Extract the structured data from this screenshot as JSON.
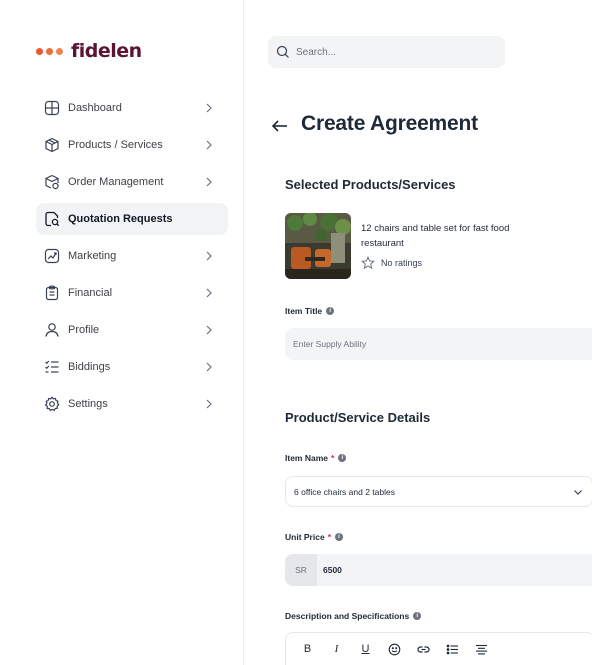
{
  "brand": {
    "name": "fidelen"
  },
  "search": {
    "placeholder": "Search..."
  },
  "sidebar": {
    "items": [
      {
        "label": "Dashboard",
        "icon": "dashboard-icon"
      },
      {
        "label": "Products / Services",
        "icon": "box-icon"
      },
      {
        "label": "Order Management",
        "icon": "order-icon"
      },
      {
        "label": "Quotation Requests",
        "icon": "quotation-icon",
        "active": true
      },
      {
        "label": "Marketing",
        "icon": "chart-icon"
      },
      {
        "label": "Financial",
        "icon": "receipt-icon"
      },
      {
        "label": "Profile",
        "icon": "user-icon"
      },
      {
        "label": "Biddings",
        "icon": "list-icon"
      },
      {
        "label": "Settings",
        "icon": "gear-icon"
      }
    ]
  },
  "page": {
    "title": "Create Agreement",
    "selected_section": "Selected Products/Services",
    "details_section": "Product/Service Details"
  },
  "product": {
    "name": "12 chairs and table set for fast food restaurant",
    "rating_text": "No ratings"
  },
  "fields": {
    "item_title": {
      "label": "Item Title",
      "placeholder": "Enter Supply Ability"
    },
    "item_name": {
      "label": "Item Name",
      "required": "*",
      "value": "6 office chairs and 2 tables"
    },
    "unit_price": {
      "label": "Unit Price",
      "required": "*",
      "prefix": "SR",
      "value": "6500"
    },
    "description": {
      "label": "Description and Specifications"
    }
  },
  "editor_toolbar": {
    "bold": "B",
    "italic": "I",
    "underline": "U"
  },
  "colors": {
    "brand": "#5a1434",
    "accent": "#e85a2a",
    "required": "#e11d48"
  }
}
